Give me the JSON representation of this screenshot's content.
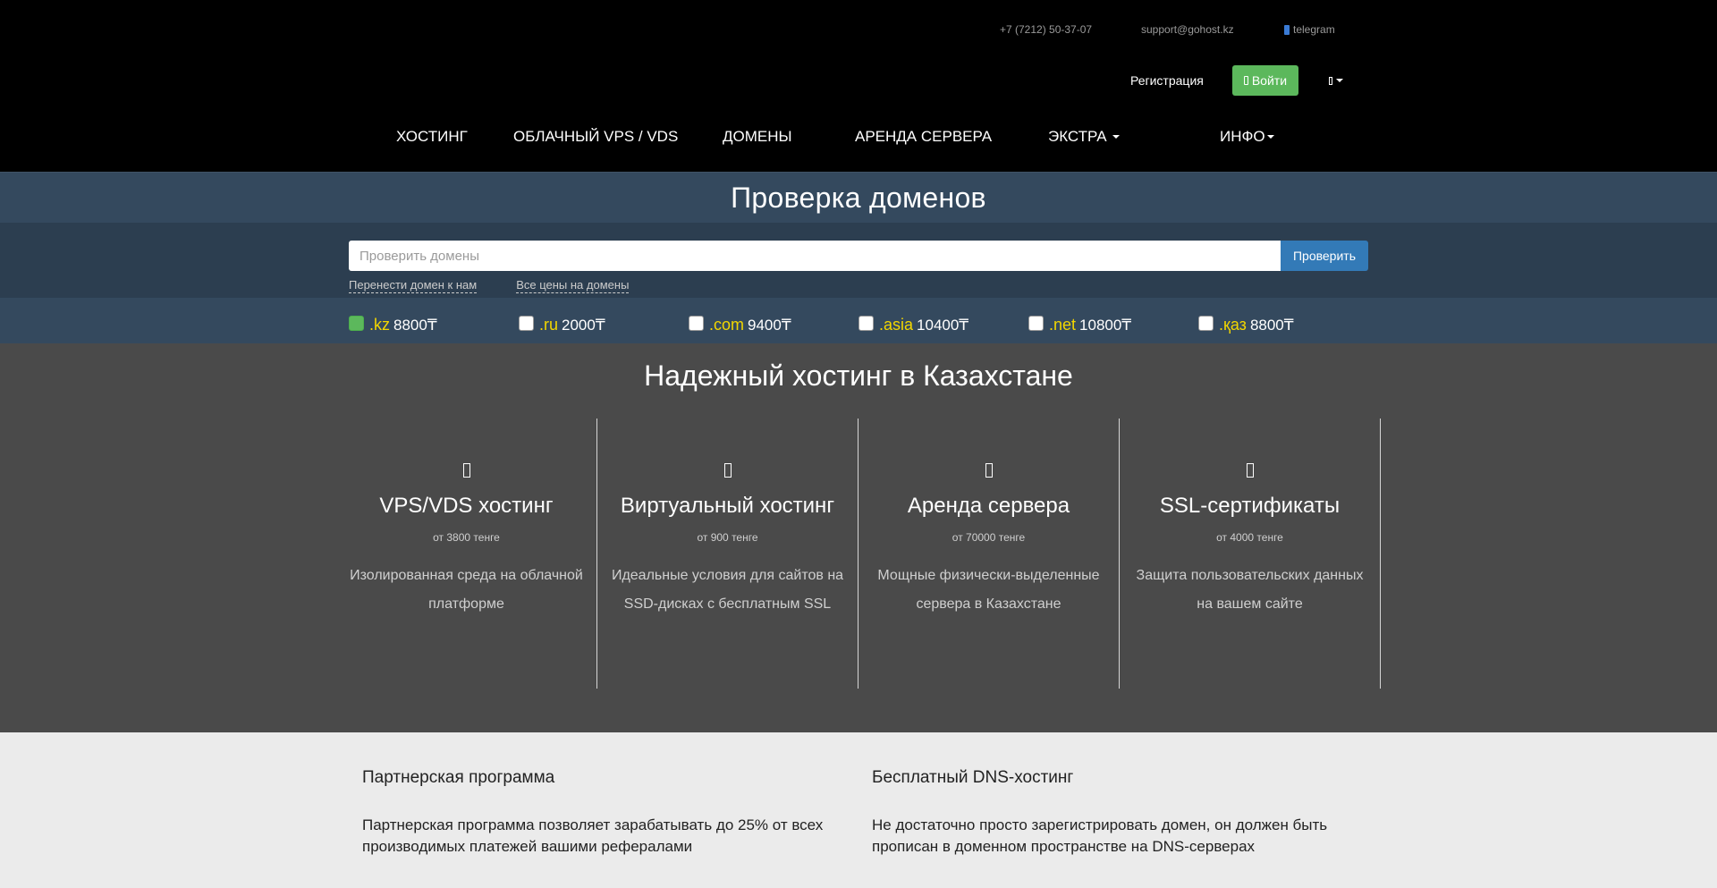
{
  "topbar": {
    "phone": "+7 (7212) 50-37-07",
    "email": "support@gohost.kz",
    "telegram": "telegram",
    "register": "Регистрация",
    "login": "Войти"
  },
  "nav": {
    "hosting": "ХОСТИНГ",
    "vps": "ОБЛАЧНЫЙ VPS / VDS",
    "domains": "ДОМЕНЫ",
    "server": "АРЕНДА СЕРВЕРА",
    "extra": "ЭКСТРА",
    "info": "ИНФО"
  },
  "domain_check": {
    "title": "Проверка доменов",
    "placeholder": "Проверить домены",
    "button": "Проверить",
    "transfer_link": "Перенести домен к нам",
    "prices_link": "Все цены на домены",
    "zones": [
      {
        "ext": ".kz",
        "price": "8800₸",
        "checked": true
      },
      {
        "ext": ".ru",
        "price": "2000₸",
        "checked": false
      },
      {
        "ext": ".com",
        "price": "9400₸",
        "checked": false
      },
      {
        "ext": ".asia",
        "price": "10400₸",
        "checked": false
      },
      {
        "ext": ".net",
        "price": "10800₸",
        "checked": false
      },
      {
        "ext": ".қаз",
        "price": "8800₸",
        "checked": false
      }
    ]
  },
  "hosting": {
    "title": "Надежный хостинг в Казахстане",
    "cards": [
      {
        "title": "VPS/VDS хостинг",
        "price": "от 3800 тенге",
        "desc": "Изолированная среда на облачной платформе"
      },
      {
        "title": "Виртуальный хостинг",
        "price": "от 900 тенге",
        "desc": "Идеальные условия для сайтов на SSD-дисках с бесплатным SSL"
      },
      {
        "title": "Аренда сервера",
        "price": "от 70000 тенге",
        "desc": "Мощные физически-выделенные сервера в Казахстане"
      },
      {
        "title": "SSL-сертификаты",
        "price": "от 4000 тенге",
        "desc": "Защита пользовательских данных на вашем сайте"
      }
    ]
  },
  "info": {
    "partner_title": "Партнерская программа",
    "partner_text": "Партнерская программа позволяет зарабатывать до 25% от всех производимых платежей вашими рефералами",
    "dns_title": "Бесплатный DNS-хостинг",
    "dns_text": "Не достаточно просто зарегистрировать домен, он должен быть прописан в доменном пространстве на DNS-серверах"
  },
  "colors": {
    "accent_green": "#5cb85c",
    "accent_blue": "#337ab7",
    "zone_yellow": "#f2d600"
  }
}
